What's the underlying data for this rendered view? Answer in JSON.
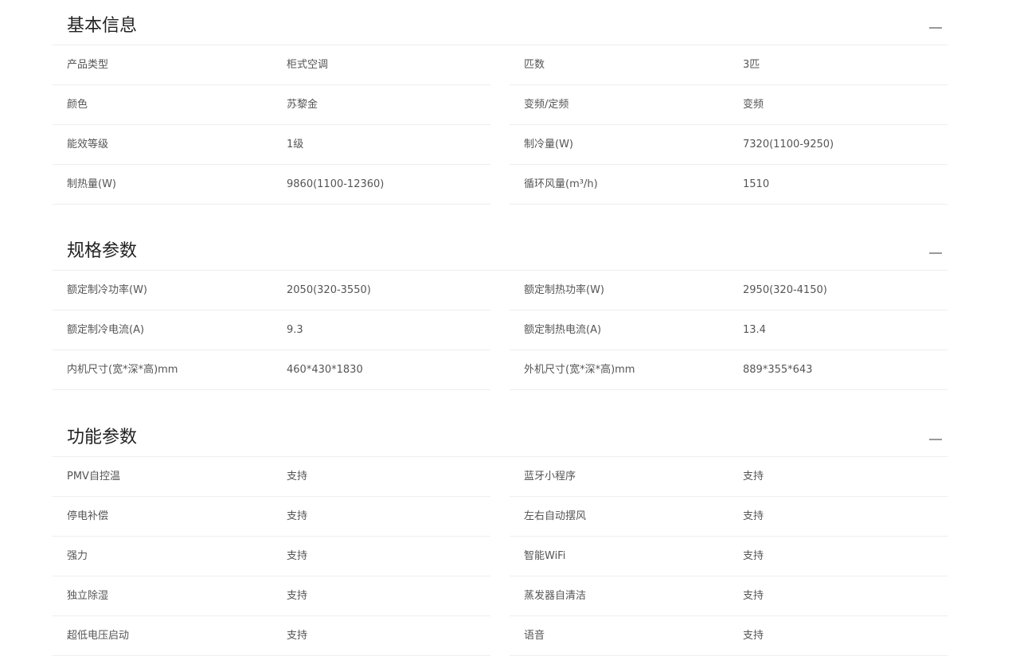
{
  "sections": [
    {
      "title": "基本信息",
      "rows": [
        [
          {
            "label": "产品类型",
            "value": "柜式空调"
          },
          {
            "label": "匹数",
            "value": "3匹"
          }
        ],
        [
          {
            "label": "颜色",
            "value": "苏黎金"
          },
          {
            "label": "变频/定频",
            "value": "变频"
          }
        ],
        [
          {
            "label": "能效等级",
            "value": "1级"
          },
          {
            "label": "制冷量(W)",
            "value": "7320(1100-9250)"
          }
        ],
        [
          {
            "label": "制热量(W)",
            "value": "9860(1100-12360)"
          },
          {
            "label": "循环风量(m³/h)",
            "value": "1510"
          }
        ]
      ]
    },
    {
      "title": "规格参数",
      "rows": [
        [
          {
            "label": "额定制冷功率(W)",
            "value": "2050(320-3550)"
          },
          {
            "label": "额定制热功率(W)",
            "value": "2950(320-4150)"
          }
        ],
        [
          {
            "label": "额定制冷电流(A)",
            "value": "9.3"
          },
          {
            "label": "额定制热电流(A)",
            "value": "13.4"
          }
        ],
        [
          {
            "label": "内机尺寸(宽*深*高)mm",
            "value": "460*430*1830"
          },
          {
            "label": "外机尺寸(宽*深*高)mm",
            "value": "889*355*643"
          }
        ]
      ]
    },
    {
      "title": "功能参数",
      "rows": [
        [
          {
            "label": "PMV自控温",
            "value": "支持"
          },
          {
            "label": "蓝牙小程序",
            "value": "支持"
          }
        ],
        [
          {
            "label": "停电补偿",
            "value": "支持"
          },
          {
            "label": "左右自动摆风",
            "value": "支持"
          }
        ],
        [
          {
            "label": "强力",
            "value": "支持"
          },
          {
            "label": "智能WiFi",
            "value": "支持"
          }
        ],
        [
          {
            "label": "独立除湿",
            "value": "支持"
          },
          {
            "label": "蒸发器自清洁",
            "value": "支持"
          }
        ],
        [
          {
            "label": "超低电压启动",
            "value": "支持"
          },
          {
            "label": "语音",
            "value": "支持"
          }
        ]
      ]
    }
  ]
}
